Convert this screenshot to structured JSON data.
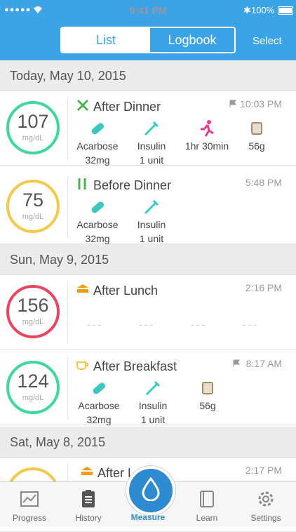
{
  "status": {
    "time": "9:41 PM",
    "battery": "100%"
  },
  "header": {
    "segment": {
      "list": "List",
      "logbook": "Logbook"
    },
    "select": "Select"
  },
  "sections": [
    {
      "label": "Today, May 10, 2015"
    },
    {
      "label": "Sun, May 9, 2015"
    },
    {
      "label": "Sat, May 8, 2015"
    }
  ],
  "entries": [
    {
      "value": "107",
      "unit": "mg/dL",
      "title": "After Dinner",
      "time": "10:03 PM",
      "items": [
        {
          "line1": "Acarbose",
          "line2": "32mg"
        },
        {
          "line1": "Insulin",
          "line2": "1 unit"
        },
        {
          "line1": "1hr 30min",
          "line2": ""
        },
        {
          "line1": "56g",
          "line2": ""
        }
      ]
    },
    {
      "value": "75",
      "unit": "mg/dL",
      "title": "Before Dinner",
      "time": "5:48 PM",
      "items": [
        {
          "line1": "Acarbose",
          "line2": "32mg"
        },
        {
          "line1": "Insulin",
          "line2": "1 unit"
        }
      ]
    },
    {
      "value": "156",
      "unit": "mg/dL",
      "title": "After Lunch",
      "time": "2:16 PM",
      "placeholder": "---"
    },
    {
      "value": "124",
      "unit": "mg/dL",
      "title": "After Breakfast",
      "time": "8:17 AM",
      "items": [
        {
          "line1": "Acarbose",
          "line2": "32mg"
        },
        {
          "line1": "Insulin",
          "line2": "1 unit"
        },
        {
          "line1": "56g",
          "line2": ""
        }
      ]
    },
    {
      "title": "After L",
      "time": "2:17 PM"
    }
  ],
  "tabs": {
    "progress": "Progress",
    "history": "History",
    "measure": "Measure",
    "learn": "Learn",
    "settings": "Settings"
  },
  "colors": {
    "accent": "#3ba3e6",
    "green": "#3dd89a",
    "yellow": "#f3c94a",
    "red": "#e94560"
  }
}
